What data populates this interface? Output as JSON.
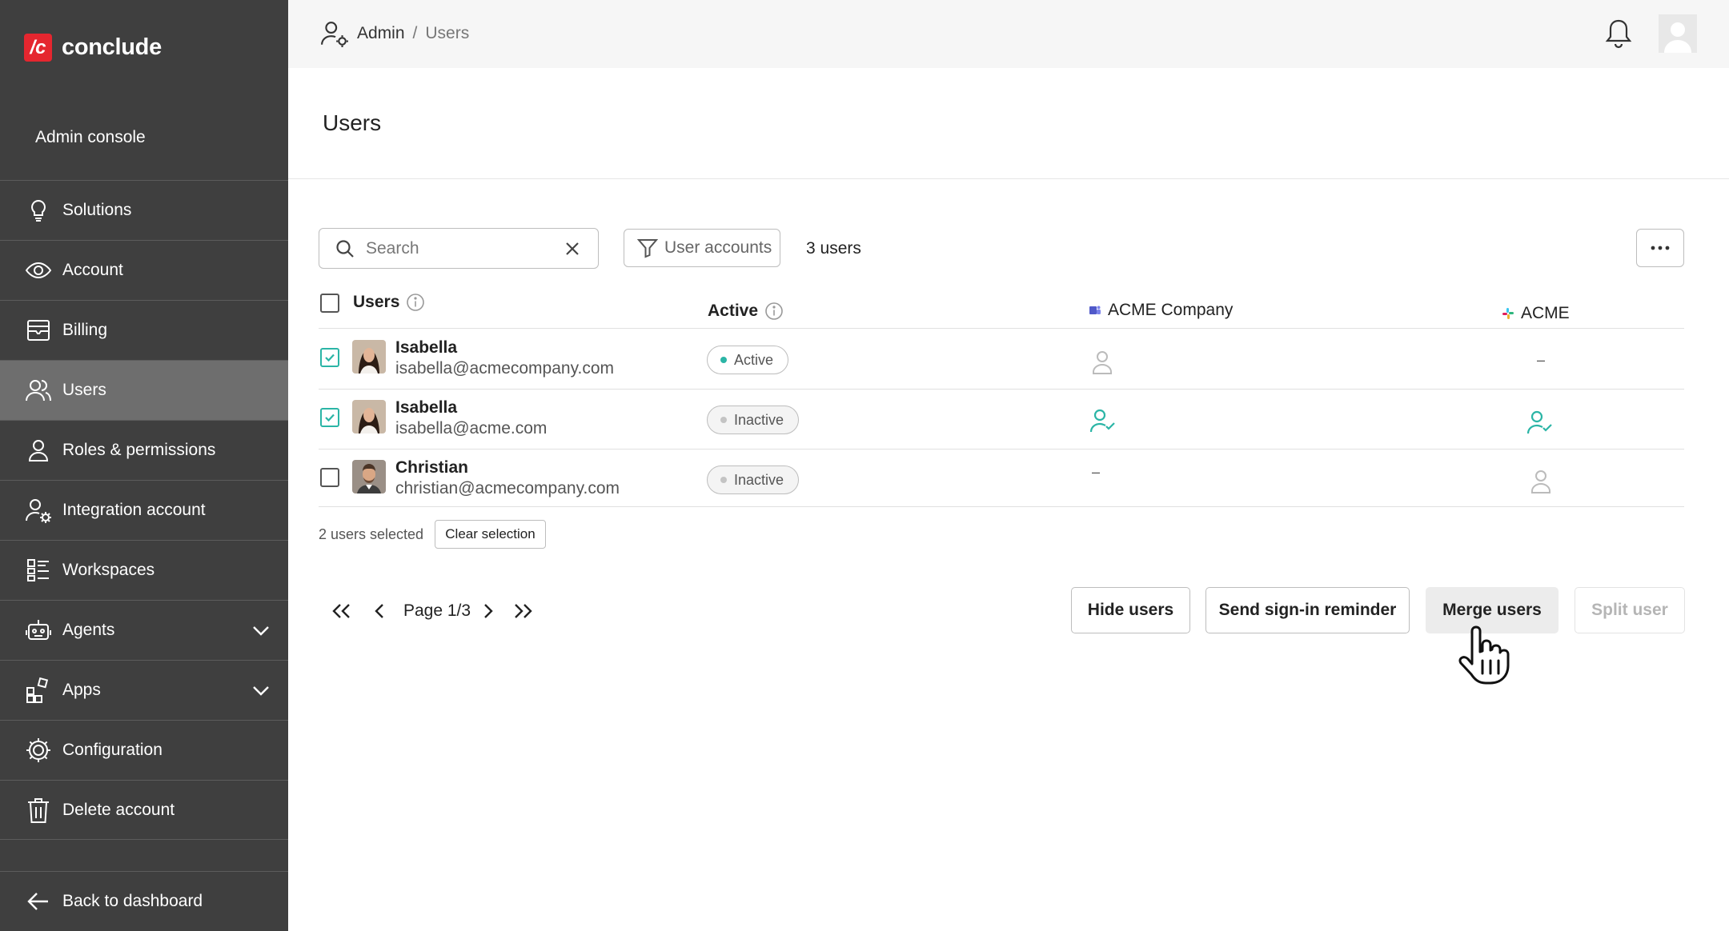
{
  "brand": {
    "logo_glyph": "/c",
    "name": "conclude",
    "accent": "#e5262f"
  },
  "sidebar": {
    "console_label": "Admin console",
    "items": [
      {
        "label": "Solutions",
        "icon": "lightbulb-icon"
      },
      {
        "label": "Account",
        "icon": "eye-icon"
      },
      {
        "label": "Billing",
        "icon": "billing-icon"
      },
      {
        "label": "Users",
        "icon": "users-icon",
        "active": true
      },
      {
        "label": "Roles & permissions",
        "icon": "person-icon"
      },
      {
        "label": "Integration account",
        "icon": "person-gear-icon"
      },
      {
        "label": "Workspaces",
        "icon": "workspaces-icon"
      },
      {
        "label": "Agents",
        "icon": "robot-icon",
        "expandable": true
      },
      {
        "label": "Apps",
        "icon": "apps-icon",
        "expandable": true
      },
      {
        "label": "Configuration",
        "icon": "gear-icon"
      },
      {
        "label": "Delete account",
        "icon": "trash-icon"
      }
    ],
    "back_label": "Back to dashboard"
  },
  "header": {
    "breadcrumb": {
      "root": "Admin",
      "separator": "/",
      "current": "Users"
    }
  },
  "page": {
    "title": "Users"
  },
  "toolbar": {
    "search_placeholder": "Search",
    "filter_label": "User accounts",
    "count_label": "3 users"
  },
  "table": {
    "columns": {
      "users": "Users",
      "active": "Active",
      "company1": "ACME Company",
      "company2": "ACME"
    },
    "rows": [
      {
        "name": "Isabella",
        "email": "isabella@acmecompany.com",
        "status": "Active",
        "checked": true,
        "company1": "user-icon",
        "company2": "–"
      },
      {
        "name": "Isabella",
        "email": "isabella@acme.com",
        "status": "Inactive",
        "checked": true,
        "company1": "user-check-icon",
        "company2": "user-check-icon"
      },
      {
        "name": "Christian",
        "email": "christian@acmecompany.com",
        "status": "Inactive",
        "checked": false,
        "company1": "–",
        "company2": "user-icon"
      }
    ]
  },
  "selection": {
    "text": "2 users selected",
    "clear_label": "Clear selection"
  },
  "pagination": {
    "label": "Page 1/3"
  },
  "actions": {
    "hide": "Hide users",
    "reminder": "Send sign-in reminder",
    "merge": "Merge users",
    "split": "Split user"
  },
  "colors": {
    "sidebar_bg": "#3f3f3f",
    "teal": "#2bb5a6",
    "topbar_bg": "#f6f6f6"
  }
}
